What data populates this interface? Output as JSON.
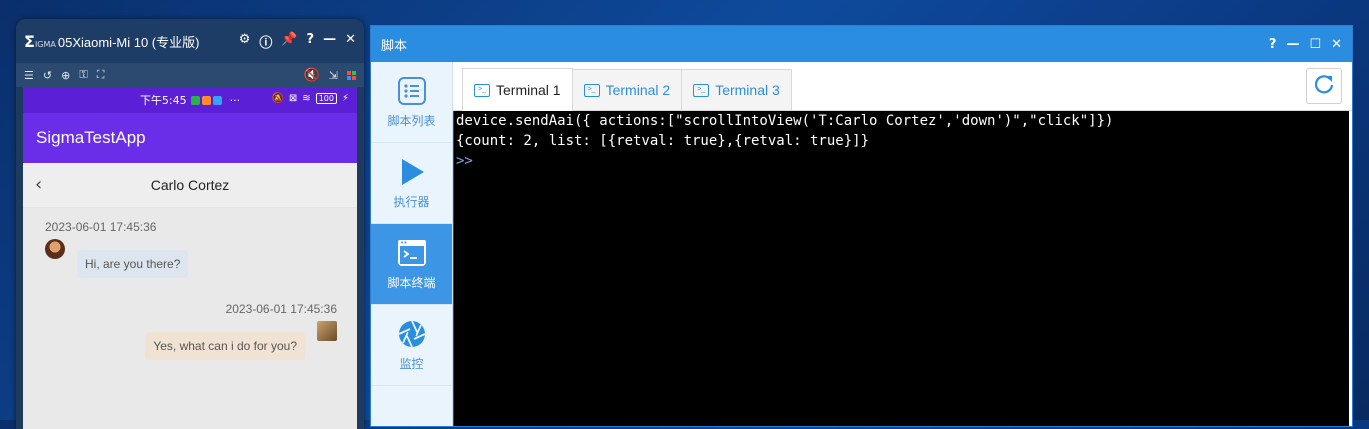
{
  "phone_window": {
    "logo": "Σ",
    "logo_sub": "IGMA",
    "title": "05Xiaomi-Mi 10 (专业版)",
    "toolbar_icons": [
      "list-icon",
      "rotate-icon",
      "zoom-icon",
      "key-icon",
      "expand-icon",
      "mute-icon",
      "export-icon",
      "grid-icon"
    ],
    "status_time": "下午5:45",
    "status_dots": "···",
    "battery": "100",
    "app_title": "SigmaTestApp",
    "chat_title": "Carlo Cortez",
    "messages": [
      {
        "time": "2023-06-01 17:45:36",
        "text": "Hi, are you there?",
        "side": "left"
      },
      {
        "time": "2023-06-01 17:45:36",
        "text": "Yes, what can i do for you?",
        "side": "right"
      }
    ]
  },
  "script_window": {
    "title": "脚本",
    "sidebar": [
      {
        "label": "脚本列表",
        "icon": "list-icon"
      },
      {
        "label": "执行器",
        "icon": "play-icon"
      },
      {
        "label": "脚本终端",
        "icon": "terminal-icon",
        "active": true
      },
      {
        "label": "监控",
        "icon": "camera-shutter-icon"
      }
    ],
    "tabs": [
      {
        "label": "Terminal 1",
        "active": true
      },
      {
        "label": "Terminal 2"
      },
      {
        "label": "Terminal 3"
      }
    ],
    "terminal_lines": [
      "device.sendAai({ actions:[\"scrollIntoView('T:Carlo Cortez','down')\",\"click\"]})",
      "{count: 2, list: [{retval: true},{retval: true}]}"
    ],
    "prompt": ">>"
  },
  "colors": {
    "accent": "#2b8de0",
    "app_bar": "#6a2de8",
    "status_bar": "#5b1fd6",
    "terminal_bg": "#000000"
  }
}
